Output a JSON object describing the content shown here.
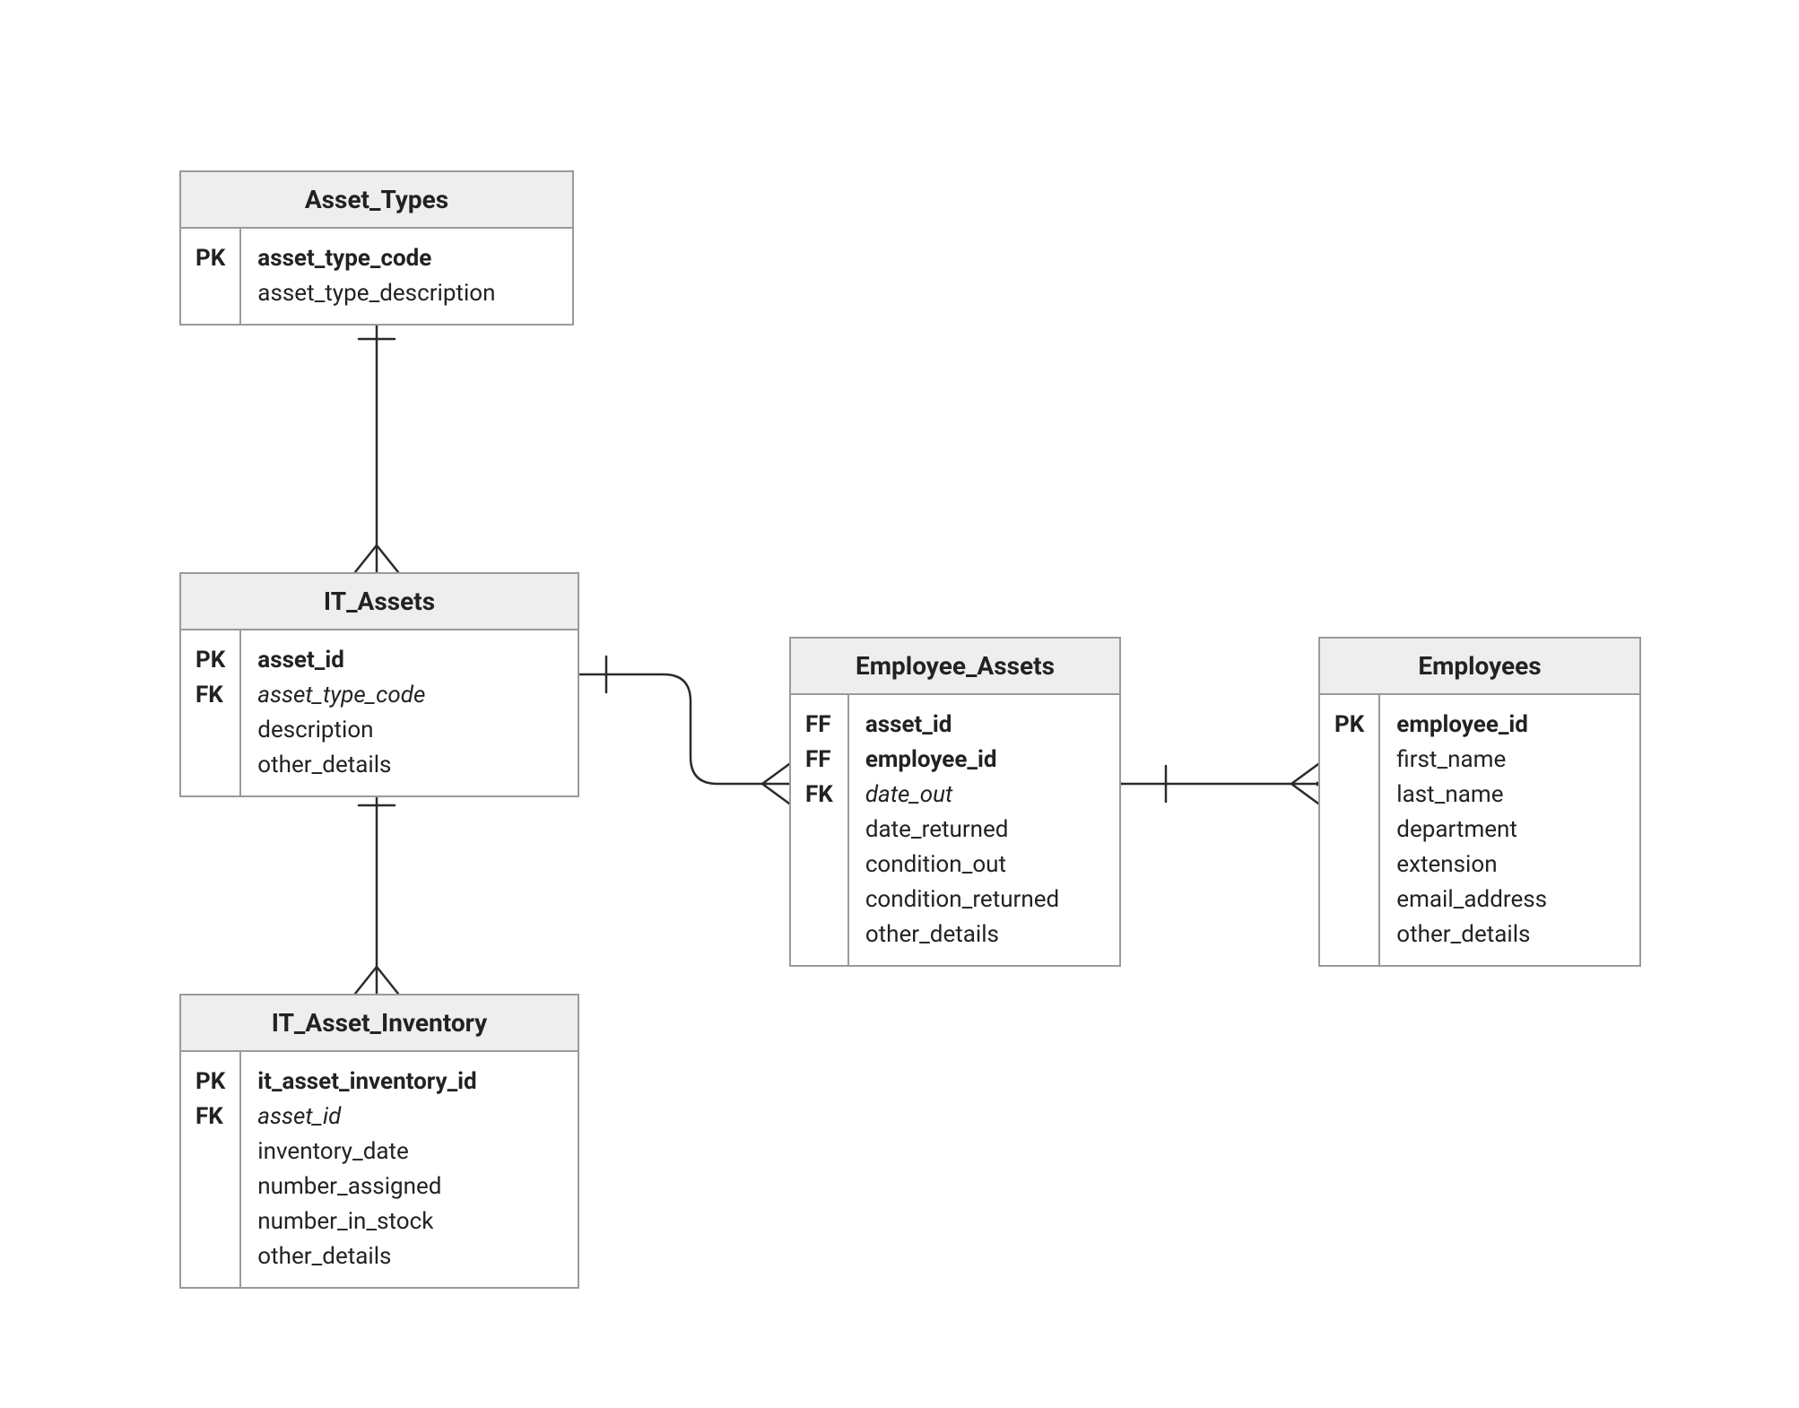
{
  "entities": {
    "asset_types": {
      "title": "Asset_Types",
      "keys": [
        "PK",
        ""
      ],
      "fields": [
        {
          "text": "asset_type_code",
          "bold": true
        },
        {
          "text": "asset_type_description"
        }
      ]
    },
    "it_assets": {
      "title": "IT_Assets",
      "keys": [
        "PK",
        "FK",
        "",
        ""
      ],
      "fields": [
        {
          "text": "asset_id",
          "bold": true
        },
        {
          "text": "asset_type_code",
          "italic": true
        },
        {
          "text": "description"
        },
        {
          "text": "other_details"
        }
      ]
    },
    "it_asset_inventory": {
      "title": "IT_Asset_Inventory",
      "keys": [
        "PK",
        "FK",
        "",
        "",
        "",
        ""
      ],
      "fields": [
        {
          "text": "it_asset_inventory_id",
          "bold": true
        },
        {
          "text": "asset_id",
          "italic": true
        },
        {
          "text": "inventory_date"
        },
        {
          "text": "number_assigned"
        },
        {
          "text": "number_in_stock"
        },
        {
          "text": "other_details"
        }
      ]
    },
    "employee_assets": {
      "title": "Employee_Assets",
      "keys": [
        "FF",
        "FF",
        "FK",
        "",
        "",
        "",
        ""
      ],
      "fields": [
        {
          "text": "asset_id",
          "bold": true
        },
        {
          "text": "employee_id",
          "bold": true
        },
        {
          "text": "date_out",
          "italic": true
        },
        {
          "text": "date_returned"
        },
        {
          "text": "condition_out"
        },
        {
          "text": "condition_returned"
        },
        {
          "text": "other_details"
        }
      ]
    },
    "employees": {
      "title": "Employees",
      "keys": [
        "PK",
        "",
        "",
        "",
        "",
        "",
        ""
      ],
      "fields": [
        {
          "text": "employee_id",
          "bold": true
        },
        {
          "text": "first_name"
        },
        {
          "text": "last_name"
        },
        {
          "text": "department"
        },
        {
          "text": "extension"
        },
        {
          "text": "email_address"
        },
        {
          "text": "other_details"
        }
      ]
    }
  },
  "relationships": [
    {
      "from": "Asset_Types",
      "to": "IT_Assets",
      "type": "one-to-many"
    },
    {
      "from": "IT_Assets",
      "to": "IT_Asset_Inventory",
      "type": "one-to-many"
    },
    {
      "from": "IT_Assets",
      "to": "Employee_Assets",
      "type": "one-to-many"
    },
    {
      "from": "Employees",
      "to": "Employee_Assets",
      "type": "one-to-many"
    }
  ]
}
